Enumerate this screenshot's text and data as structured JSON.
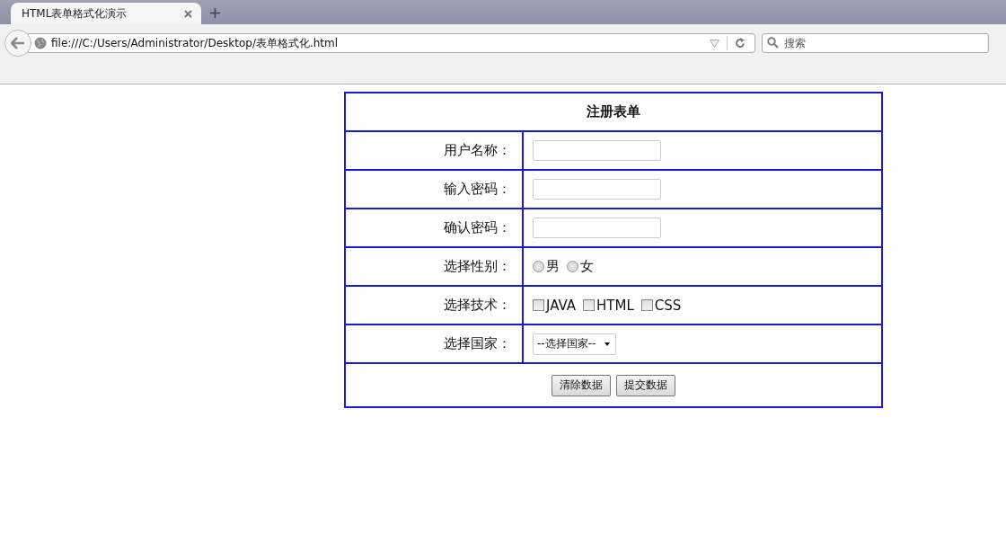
{
  "browser": {
    "tab": {
      "title": "HTML表单格式化演示",
      "selected": true
    },
    "address": "file:///C:/Users/Administrator/Desktop/表单格式化.html",
    "search": {
      "placeholder": "搜索"
    }
  },
  "form": {
    "title": "注册表单",
    "rows": [
      {
        "kind": "text",
        "label": "用户名称：",
        "value": ""
      },
      {
        "kind": "text",
        "label": "输入密码：",
        "value": ""
      },
      {
        "kind": "text",
        "label": "确认密码：",
        "value": ""
      },
      {
        "kind": "radio",
        "label": "选择性别：",
        "options": [
          {
            "label": "男",
            "selected": false
          },
          {
            "label": "女",
            "selected": false
          }
        ]
      },
      {
        "kind": "checkbox",
        "label": "选择技术：",
        "options": [
          {
            "label": "JAVA",
            "checked": false
          },
          {
            "label": "HTML",
            "checked": false
          },
          {
            "label": "CSS",
            "checked": false
          }
        ]
      },
      {
        "kind": "select",
        "label": "选择国家：",
        "value": "--选择国家--"
      }
    ],
    "buttons": [
      "清除数据",
      "提交数据"
    ]
  }
}
